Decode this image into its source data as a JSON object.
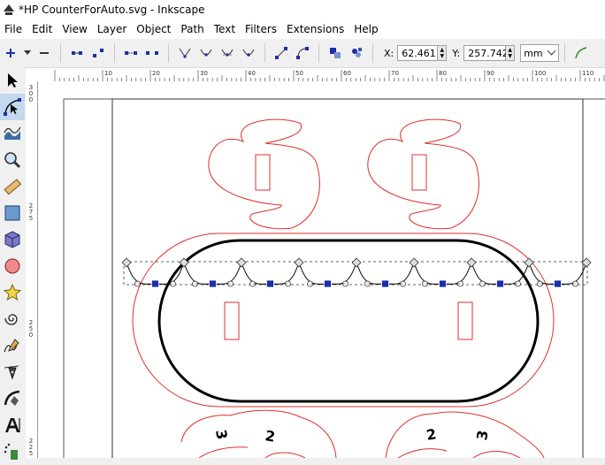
{
  "window": {
    "title": "*HP CounterForAuto.svg - Inkscape"
  },
  "menu": [
    "File",
    "Edit",
    "View",
    "Layer",
    "Object",
    "Path",
    "Text",
    "Filters",
    "Extensions",
    "Help"
  ],
  "coords": {
    "x_label": "X:",
    "x_value": "62.461",
    "y_label": "Y:",
    "y_value": "257.742",
    "unit": "mm"
  },
  "ruler": {
    "h_labels": [
      "10",
      "20",
      "30",
      "40",
      "50",
      "60",
      "70",
      "80",
      "90",
      "100",
      "110"
    ],
    "v_labels": [
      {
        "text": "300"
      },
      {
        "text": "275"
      },
      {
        "text": "250"
      },
      {
        "text": "225"
      }
    ]
  },
  "canvas_text": {
    "gear_left": [
      "3",
      "2"
    ],
    "gear_right": [
      "2",
      "3"
    ]
  },
  "colors": {
    "cut_line": "#e0302a",
    "handle": "#1a2fa8",
    "path": "#000000",
    "active_tool": "#c4d8ef"
  },
  "tools": [
    "selector-tool",
    "node-tool",
    "tweak-tool",
    "zoom-tool",
    "measure-tool",
    "rect-tool",
    "3dbox-tool",
    "ellipse-tool",
    "star-tool",
    "spiral-tool",
    "pencil-tool",
    "pen-tool",
    "calligraphy-tool",
    "text-tool",
    "spray-tool"
  ]
}
